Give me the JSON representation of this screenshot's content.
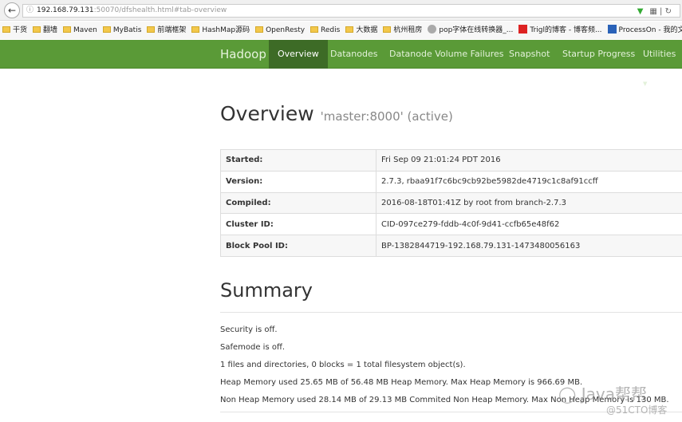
{
  "browser": {
    "url_host": "192.168.79.131",
    "url_rest": ":50070/dfshealth.html#tab-overview",
    "bookmarks": [
      {
        "label": "干货",
        "icon": "folder-icon"
      },
      {
        "label": "翻墙",
        "icon": "folder-icon"
      },
      {
        "label": "Maven",
        "icon": "folder-icon"
      },
      {
        "label": "MyBatis",
        "icon": "folder-icon"
      },
      {
        "label": "前端框架",
        "icon": "folder-icon"
      },
      {
        "label": "HashMap源码",
        "icon": "folder-icon"
      },
      {
        "label": "OpenResty",
        "icon": "folder-icon"
      },
      {
        "label": "Redis",
        "icon": "folder-icon"
      },
      {
        "label": "大数据",
        "icon": "folder-icon"
      },
      {
        "label": "杭州租房",
        "icon": "folder-icon"
      },
      {
        "label": "pop字体在线转换器_...",
        "icon": "globe-icon"
      },
      {
        "label": "Trigl的博客 - 博客频...",
        "icon": "csdn-icon"
      },
      {
        "label": "ProcessOn - 我的文件",
        "icon": "processon-icon"
      }
    ]
  },
  "nav": {
    "brand": "Hadoop",
    "items": [
      "Overview",
      "Datanodes",
      "Datanode Volume Failures",
      "Snapshot",
      "Startup Progress",
      "Utilities"
    ],
    "active": "Overview",
    "color": "#5a9a37"
  },
  "overview": {
    "title": "Overview",
    "subtitle": "'master:8000' (active)",
    "rows": [
      {
        "k": "Started:",
        "v": "Fri Sep 09 21:01:24 PDT 2016"
      },
      {
        "k": "Version:",
        "v": "2.7.3, rbaa91f7c6bc9cb92be5982de4719c1c8af91ccff"
      },
      {
        "k": "Compiled:",
        "v": "2016-08-18T01:41Z by root from branch-2.7.3"
      },
      {
        "k": "Cluster ID:",
        "v": "CID-097ce279-fddb-4c0f-9d41-ccfb65e48f62"
      },
      {
        "k": "Block Pool ID:",
        "v": "BP-1382844719-192.168.79.131-1473480056163"
      }
    ]
  },
  "summary": {
    "title": "Summary",
    "lines": [
      "Security is off.",
      "Safemode is off.",
      "1 files and directories, 0 blocks = 1 total filesystem object(s).",
      "Heap Memory used 25.65 MB of 56.48 MB Heap Memory. Max Heap Memory is 966.69 MB.",
      "Non Heap Memory used 28.14 MB of 29.13 MB Commited Non Heap Memory. Max Non Heap Memory is 130 MB."
    ]
  },
  "watermark": {
    "line1": "Java帮帮",
    "line2": "@51CTO博客"
  }
}
